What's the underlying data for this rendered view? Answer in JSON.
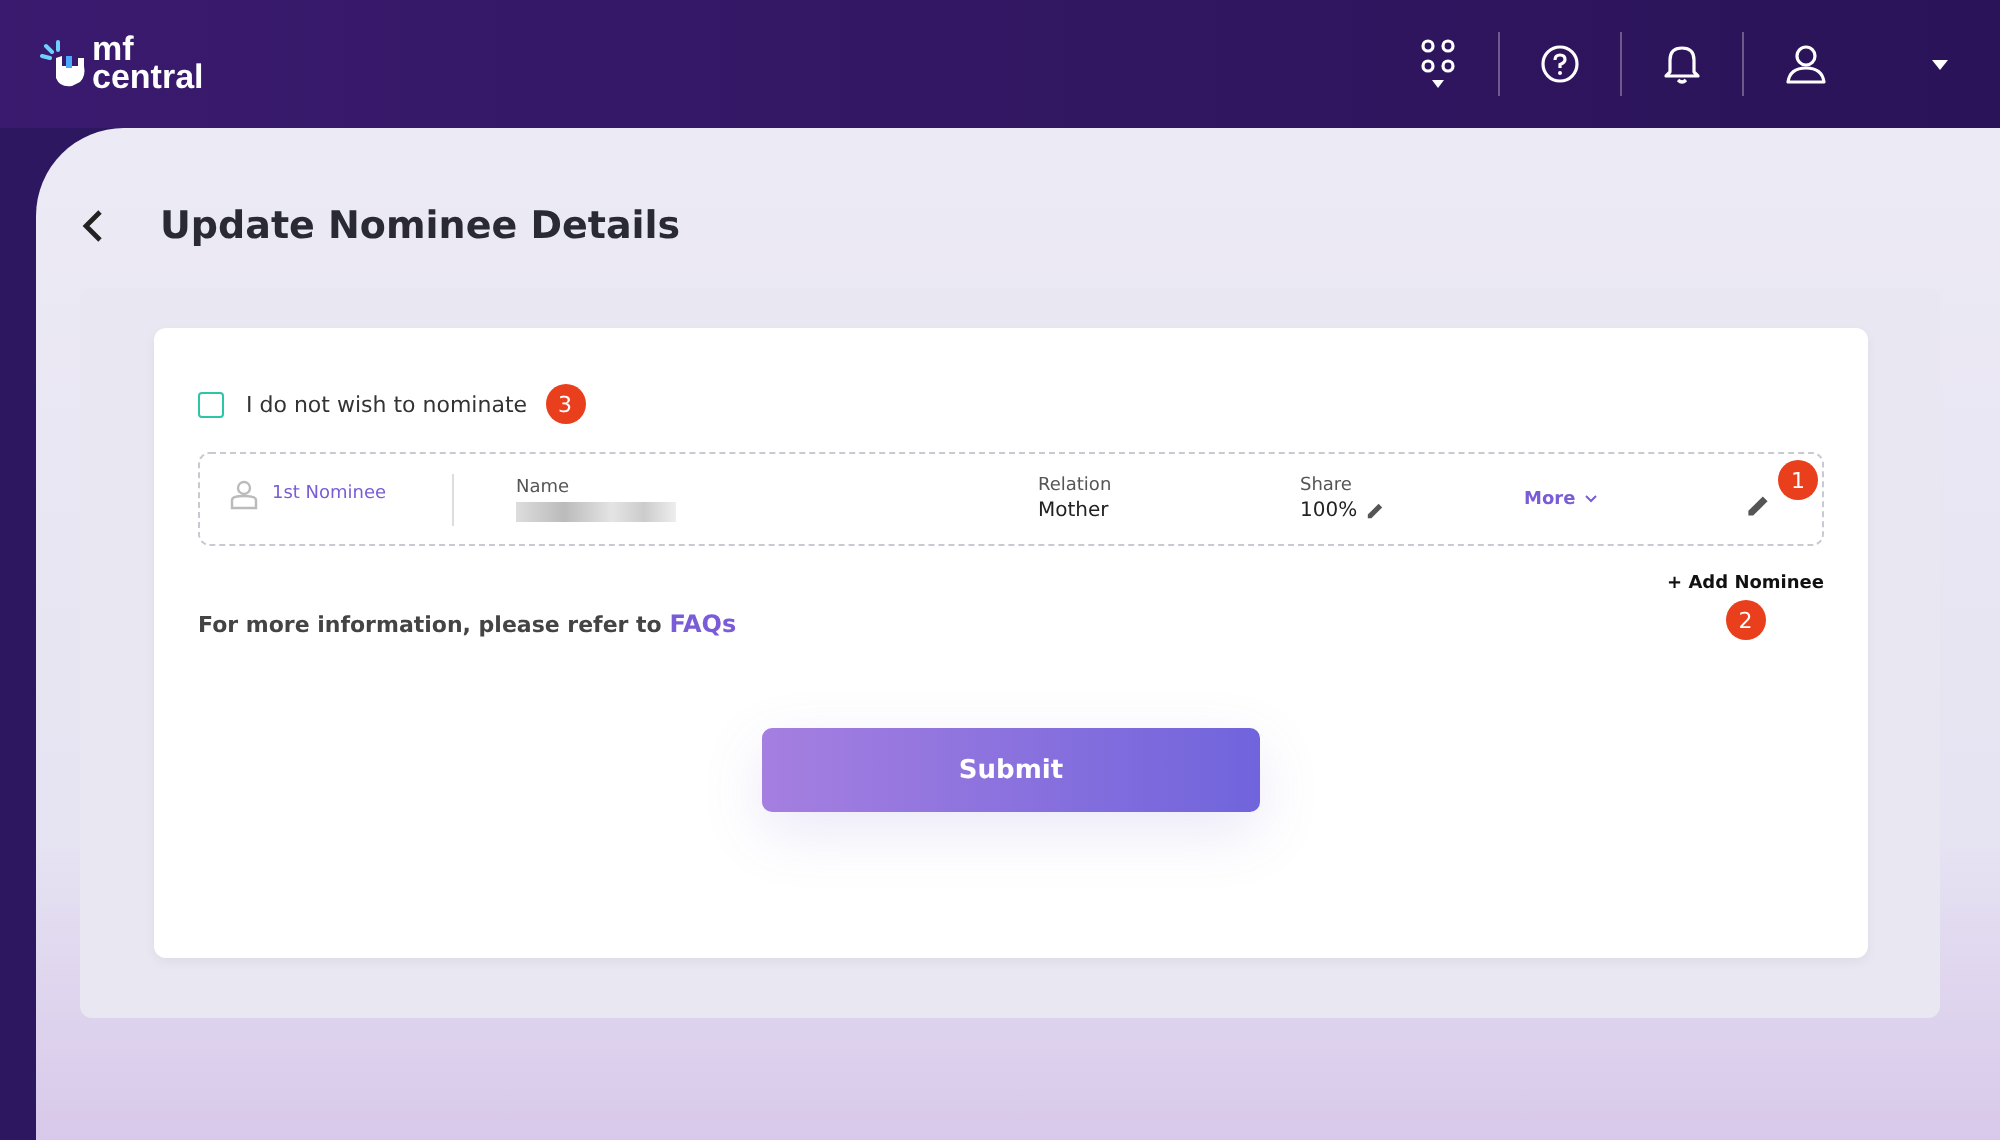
{
  "header": {
    "logo_line_1": "mf",
    "logo_line_2": "central"
  },
  "page": {
    "title": "Update Nominee Details"
  },
  "opt_out": {
    "label": "I do not wish to nominate",
    "checked": false,
    "marker": "3"
  },
  "nominees": [
    {
      "ordinal": "1st Nominee",
      "name_label": "Name",
      "relation_label": "Relation",
      "relation": "Mother",
      "share_label": "Share",
      "share": "100%",
      "more": "More",
      "marker": "1"
    }
  ],
  "info": {
    "text": "For more information, please refer to ",
    "link": "FAQs"
  },
  "add_nominee": {
    "label": "+ Add Nominee",
    "marker": "2"
  },
  "submit": {
    "label": "Submit"
  }
}
